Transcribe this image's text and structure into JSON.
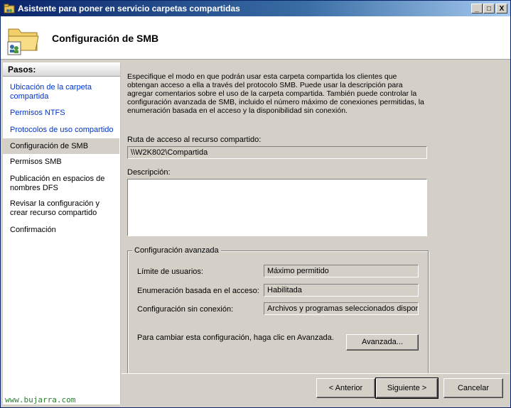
{
  "window": {
    "title": "Asistente para poner en servicio carpetas compartidas",
    "minimize": "_",
    "maximize": "□",
    "close": "X"
  },
  "header": {
    "title": "Configuración de SMB"
  },
  "steps": {
    "heading": "Pasos:",
    "items": [
      {
        "label": "Ubicación de la carpeta compartida",
        "state": "link"
      },
      {
        "label": "Permisos NTFS",
        "state": "link"
      },
      {
        "label": "Protocolos de uso compartido",
        "state": "link"
      },
      {
        "label": "Configuración de SMB",
        "state": "current"
      },
      {
        "label": "Permisos SMB",
        "state": "pending"
      },
      {
        "label": "Publicación en espacios de nombres DFS",
        "state": "pending"
      },
      {
        "label": "Revisar la configuración y crear recurso compartido",
        "state": "pending"
      },
      {
        "label": "Confirmación",
        "state": "pending"
      }
    ]
  },
  "main": {
    "description": "Especifique el modo en que podrán usar esta carpeta compartida los clientes que obtengan acceso a ella a través del protocolo SMB. Puede usar la descripción para agregar comentarios sobre el uso de la carpeta compartida. También puede controlar la configuración avanzada de SMB, incluido el número máximo de conexiones permitidas, la enumeración basada en el acceso y la disponibilidad sin conexión.",
    "share_path_label": "Ruta de acceso al recurso compartido:",
    "share_path_value": "\\\\W2K802\\Compartida",
    "description_label": "Descripción:",
    "description_value": ""
  },
  "advanced": {
    "group_label": "Configuración avanzada",
    "user_limit_label": "Límite de usuarios:",
    "user_limit_value": "Máximo permitido",
    "enum_label": "Enumeración basada en el acceso:",
    "enum_value": "Habilitada",
    "offline_label": "Configuración sin conexión:",
    "offline_value": "Archivos y programas seleccionados disponib",
    "hint": "Para cambiar esta configuración, haga clic en Avanzada.",
    "advanced_button": "Avanzada..."
  },
  "footer": {
    "back_button": "< Anterior",
    "next_button": "Siguiente >",
    "cancel_button": "Cancelar",
    "watermark": "www.bujarra.com"
  }
}
